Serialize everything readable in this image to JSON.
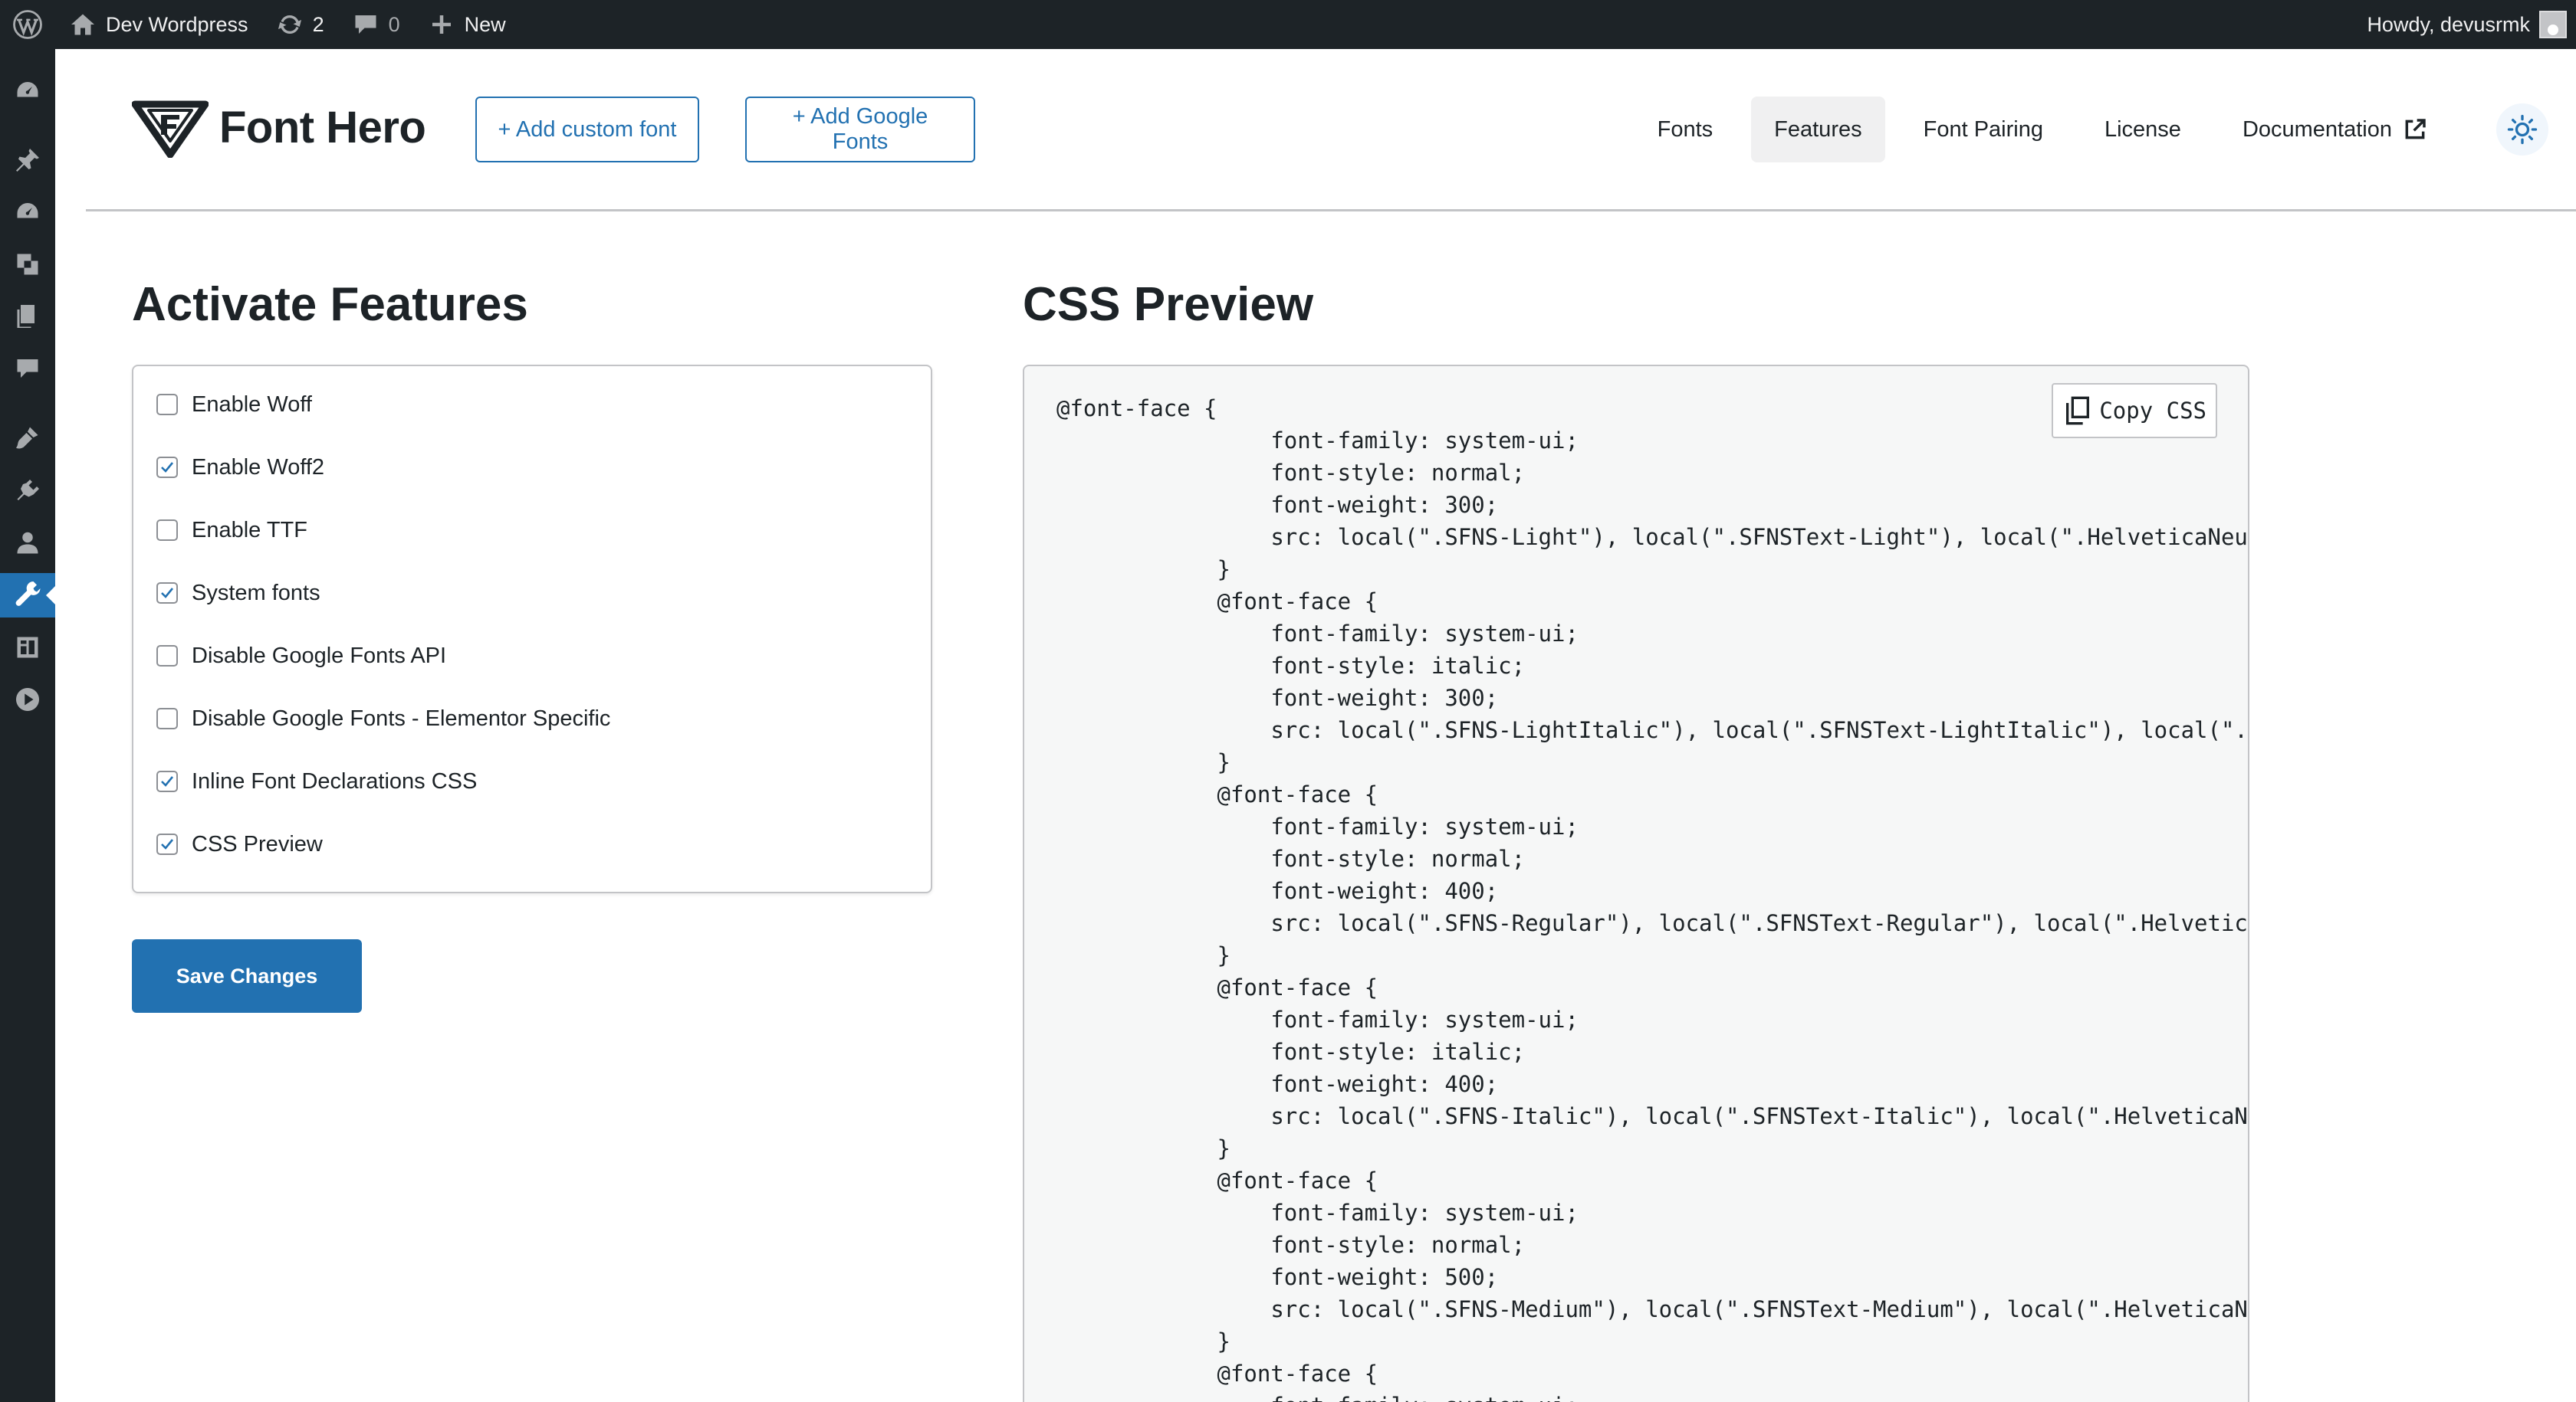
{
  "admin_bar": {
    "site_name": "Dev Wordpress",
    "updates_count": "2",
    "comments_count": "0",
    "new_label": "New",
    "greeting": "Howdy, devusrmk"
  },
  "header": {
    "logo_text": "Font Hero",
    "add_custom_font": "+ Add custom font",
    "add_google_fonts": "+ Add Google Fonts",
    "nav": [
      {
        "label": "Fonts"
      },
      {
        "label": "Features",
        "active": true
      },
      {
        "label": "Font Pairing"
      },
      {
        "label": "License"
      },
      {
        "label": "Documentation"
      }
    ]
  },
  "features": {
    "title": "Activate Features",
    "items": [
      {
        "label": "Enable Woff",
        "checked": false
      },
      {
        "label": "Enable Woff2",
        "checked": true
      },
      {
        "label": "Enable TTF",
        "checked": false
      },
      {
        "label": "System fonts",
        "checked": true
      },
      {
        "label": "Disable Google Fonts API",
        "checked": false
      },
      {
        "label": "Disable Google Fonts - Elementor Specific",
        "checked": false
      },
      {
        "label": "Inline Font Declarations CSS",
        "checked": true
      },
      {
        "label": "CSS Preview",
        "checked": true
      }
    ],
    "save_label": "Save Changes"
  },
  "preview": {
    "title": "CSS Preview",
    "copy_label": "Copy CSS",
    "code_lines": [
      "@font-face {",
      "                font-family: system-ui;",
      "                font-style: normal;",
      "                font-weight: 300;",
      "                src: local(\".SFNS-Light\"), local(\".SFNSText-Light\"), local(\".HelveticaNeue",
      "            }",
      "            @font-face {",
      "                font-family: system-ui;",
      "                font-style: italic;",
      "                font-weight: 300;",
      "                src: local(\".SFNS-LightItalic\"), local(\".SFNSText-LightItalic\"), local(\".H",
      "            }",
      "            @font-face {",
      "                font-family: system-ui;",
      "                font-style: normal;",
      "                font-weight: 400;",
      "                src: local(\".SFNS-Regular\"), local(\".SFNSText-Regular\"), local(\".Helvetica",
      "            }",
      "            @font-face {",
      "                font-family: system-ui;",
      "                font-style: italic;",
      "                font-weight: 400;",
      "                src: local(\".SFNS-Italic\"), local(\".SFNSText-Italic\"), local(\".HelveticaNe",
      "            }",
      "            @font-face {",
      "                font-family: system-ui;",
      "                font-style: normal;",
      "                font-weight: 500;",
      "                src: local(\".SFNS-Medium\"), local(\".SFNSText-Medium\"), local(\".HelveticaNe",
      "            }",
      "            @font-face {",
      "                font-family: system-ui;"
    ]
  },
  "colors": {
    "admin_bar_bg": "#1d2327",
    "accent": "#2271b1",
    "code_bg": "#f6f7f7"
  },
  "icons": {
    "admin_bar": [
      "wordpress-logo-icon",
      "home-icon",
      "updates-icon",
      "comments-icon",
      "plus-icon",
      "avatar"
    ],
    "admin_menu": [
      "dashboard-icon",
      "pin-icon",
      "gauge-icon",
      "media-icon",
      "pages-icon",
      "comments-icon",
      "appearance-icon",
      "plugins-icon",
      "users-icon",
      "tools-icon",
      "settings-icon",
      "play-icon"
    ]
  }
}
